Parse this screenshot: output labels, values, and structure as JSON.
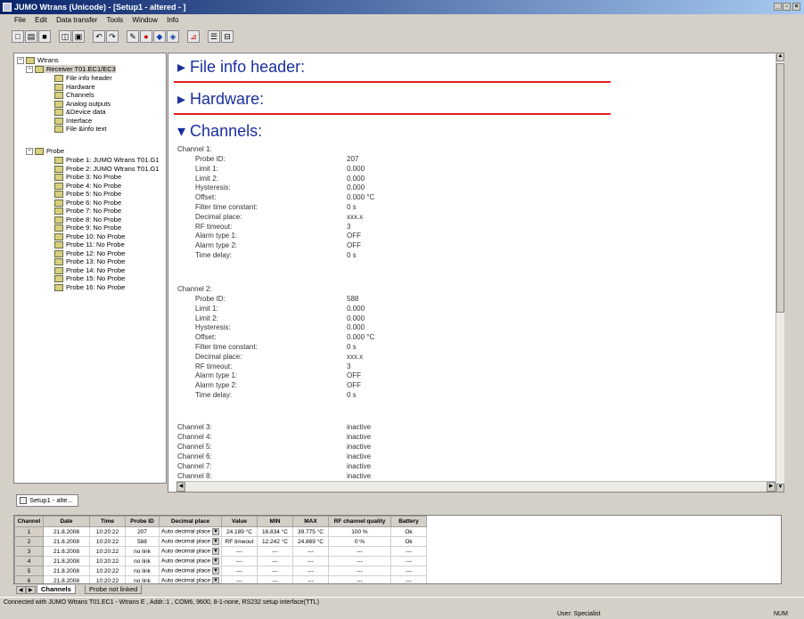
{
  "window": {
    "title": "JUMO Wtrans (Unicode) - [Setup1 - altered - ]"
  },
  "menu": [
    "File",
    "Edit",
    "Data transfer",
    "Tools",
    "Window",
    "Info"
  ],
  "tree": {
    "root": "Wtrans",
    "receiver": "Receiver T01.EC1/EC3",
    "receiver_items": [
      "File info header",
      "Hardware",
      "Channels",
      "Analog outputs",
      "&Device data",
      "Interface",
      "File &info text"
    ],
    "probe": "Probe",
    "probe_items": [
      "Probe 1: JUMO Wtrans T01.G1",
      "Probe 2: JUMO Wtrans T01.G1",
      "Probe 3: No Probe",
      "Probe 4: No Probe",
      "Probe 5: No Probe",
      "Probe 6: No Probe",
      "Probe 7: No Probe",
      "Probe 8: No Probe",
      "Probe 9: No Probe",
      "Probe 10: No Probe",
      "Probe 11: No Probe",
      "Probe 12: No Probe",
      "Probe 13: No Probe",
      "Probe 14: No Probe",
      "Probe 15: No Probe",
      "Probe 16: No Probe"
    ]
  },
  "content": {
    "sections": [
      "File info header:",
      "Hardware:",
      "Channels:"
    ],
    "channel1": {
      "title": "Channel 1:",
      "rows": [
        [
          "Probe ID:",
          "207"
        ],
        [
          "Limit 1:",
          "0.000"
        ],
        [
          "Limit 2:",
          "0.000"
        ],
        [
          "Hysteresis:",
          "0.000"
        ],
        [
          "Offset:",
          "0.000 °C"
        ],
        [
          "Filter time constant:",
          "0 s"
        ],
        [
          "Decimal place:",
          "xxx.x"
        ],
        [
          "RF timeout:",
          "3"
        ],
        [
          "Alarm type 1:",
          "OFF"
        ],
        [
          "Alarm type 2:",
          "OFF"
        ],
        [
          "Time delay:",
          "0 s"
        ]
      ]
    },
    "channel2": {
      "title": "Channel 2:",
      "rows": [
        [
          "Probe ID:",
          "588"
        ],
        [
          "Limit 1:",
          "0.000"
        ],
        [
          "Limit 2:",
          "0.000"
        ],
        [
          "Hysteresis:",
          "0.000"
        ],
        [
          "Offset:",
          "0.000 °C"
        ],
        [
          "Filter time constant:",
          "0 s"
        ],
        [
          "Decimal place:",
          "xxx.x"
        ],
        [
          "RF timeout:",
          "3"
        ],
        [
          "Alarm type 1:",
          "OFF"
        ],
        [
          "Alarm type 2:",
          "OFF"
        ],
        [
          "Time delay:",
          "0 s"
        ]
      ]
    },
    "inactive": [
      [
        "Channel 3:",
        "inactive"
      ],
      [
        "Channel 4:",
        "inactive"
      ],
      [
        "Channel 5:",
        "inactive"
      ],
      [
        "Channel 6:",
        "inactive"
      ],
      [
        "Channel 7:",
        "inactive"
      ],
      [
        "Channel 8:",
        "inactive"
      ]
    ]
  },
  "doc_tab": "Setup1 - alte...",
  "grid": {
    "headers": [
      "Channel",
      "Date",
      "Time",
      "Probe ID",
      "Decimal place",
      "Value",
      "MIN",
      "MAX",
      "RF channel quality",
      "Battery"
    ],
    "rows": [
      [
        "1",
        "21.8.2008",
        "10:20:22",
        "207",
        "Auto decimal place",
        "24.189 °C",
        "16.834 °C",
        "39.775 °C",
        "100 %",
        "Ok"
      ],
      [
        "2",
        "21.8.2008",
        "10:20:22",
        "588",
        "Auto decimal place",
        "RF timeout",
        "12.242 °C",
        "24.869 °C",
        "0 %",
        "Ok"
      ],
      [
        "3",
        "21.8.2008",
        "10:20:22",
        "no link",
        "Auto decimal place",
        "---",
        "---",
        "---",
        "---",
        "---"
      ],
      [
        "4",
        "21.8.2008",
        "10:20:22",
        "no link",
        "Auto decimal place",
        "---",
        "---",
        "---",
        "---",
        "---"
      ],
      [
        "5",
        "21.8.2008",
        "10:20:22",
        "no link",
        "Auto decimal place",
        "---",
        "---",
        "---",
        "---",
        "---"
      ],
      [
        "6",
        "21.8.2008",
        "10:20:22",
        "no link",
        "Auto decimal place",
        "---",
        "---",
        "---",
        "---",
        "---"
      ]
    ]
  },
  "sheet_tabs": [
    "Channels",
    "Probe not linked"
  ],
  "status": {
    "message": "Connected with JUMO Wtrans T01.EC1 - Wtrans E , Addr.:1 , COM6, 9600, 8-1-none, RS232 setup interface(TTL)",
    "user": "User: Specialist",
    "num": "NUM"
  }
}
